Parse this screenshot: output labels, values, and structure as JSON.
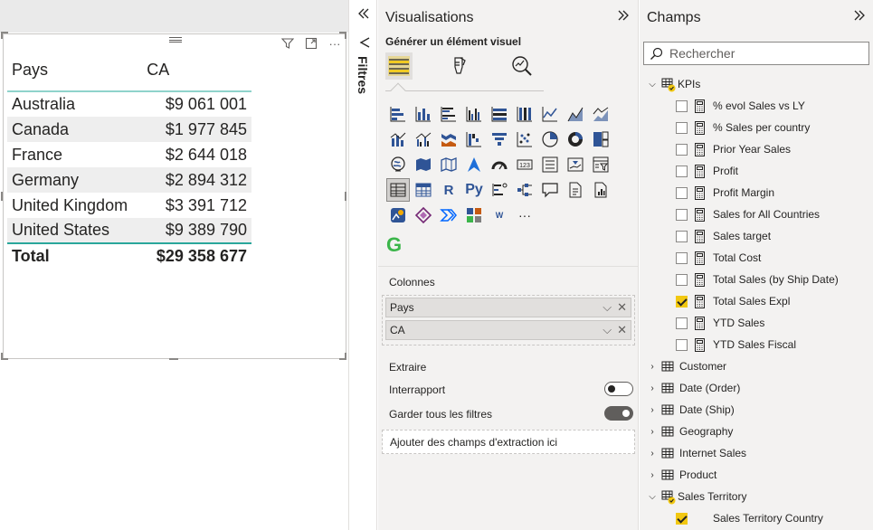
{
  "table": {
    "columns": [
      "Pays",
      "CA"
    ],
    "rows": [
      [
        "Australia",
        "$9 061 001"
      ],
      [
        "Canada",
        "$1 977 845"
      ],
      [
        "France",
        "$2 644 018"
      ],
      [
        "Germany",
        "$2 894 312"
      ],
      [
        "United Kingdom",
        "$3 391 712"
      ],
      [
        "United States",
        "$9 389 790"
      ]
    ],
    "total_label": "Total",
    "total_value": "$29 358 677"
  },
  "filters": {
    "label": "Filtres"
  },
  "visualizations": {
    "title": "Visualisations",
    "build_label": "Générer un élément visuel",
    "more": "···",
    "custom_icon": "G",
    "columns_label": "Colonnes",
    "wells": [
      "Pays",
      "CA"
    ],
    "drillthrough_label": "Extraire",
    "cross_report_label": "Interrapport",
    "cross_report_on": false,
    "keep_filters_label": "Garder tous les filtres",
    "keep_filters_on": true,
    "drop_zone": "Ajouter des champs d'extraction ici"
  },
  "fields": {
    "title": "Champs",
    "search_placeholder": "Rechercher",
    "kpi_table": "KPIs",
    "kpi_measures": [
      {
        "name": "% evol Sales vs LY",
        "checked": false
      },
      {
        "name": "% Sales per country",
        "checked": false
      },
      {
        "name": "Prior Year Sales",
        "checked": false
      },
      {
        "name": "Profit",
        "checked": false
      },
      {
        "name": "Profit Margin",
        "checked": false
      },
      {
        "name": "Sales for All Countries",
        "checked": false
      },
      {
        "name": "Sales target",
        "checked": false
      },
      {
        "name": "Total Cost",
        "checked": false
      },
      {
        "name": "Total Sales (by Ship Date)",
        "checked": false
      },
      {
        "name": "Total Sales Expl",
        "checked": true
      },
      {
        "name": "YTD Sales",
        "checked": false
      },
      {
        "name": "YTD Sales Fiscal",
        "checked": false
      }
    ],
    "tables": [
      "Customer",
      "Date (Order)",
      "Date (Ship)",
      "Geography",
      "Internet Sales",
      "Product"
    ],
    "expanded_table": "Sales Territory",
    "expanded_fields": [
      {
        "name": "Sales Territory Country",
        "checked": true
      }
    ]
  },
  "colors": {
    "accent": "#2aa79b",
    "check": "#f2c811",
    "pane": "#f3f2f1"
  }
}
